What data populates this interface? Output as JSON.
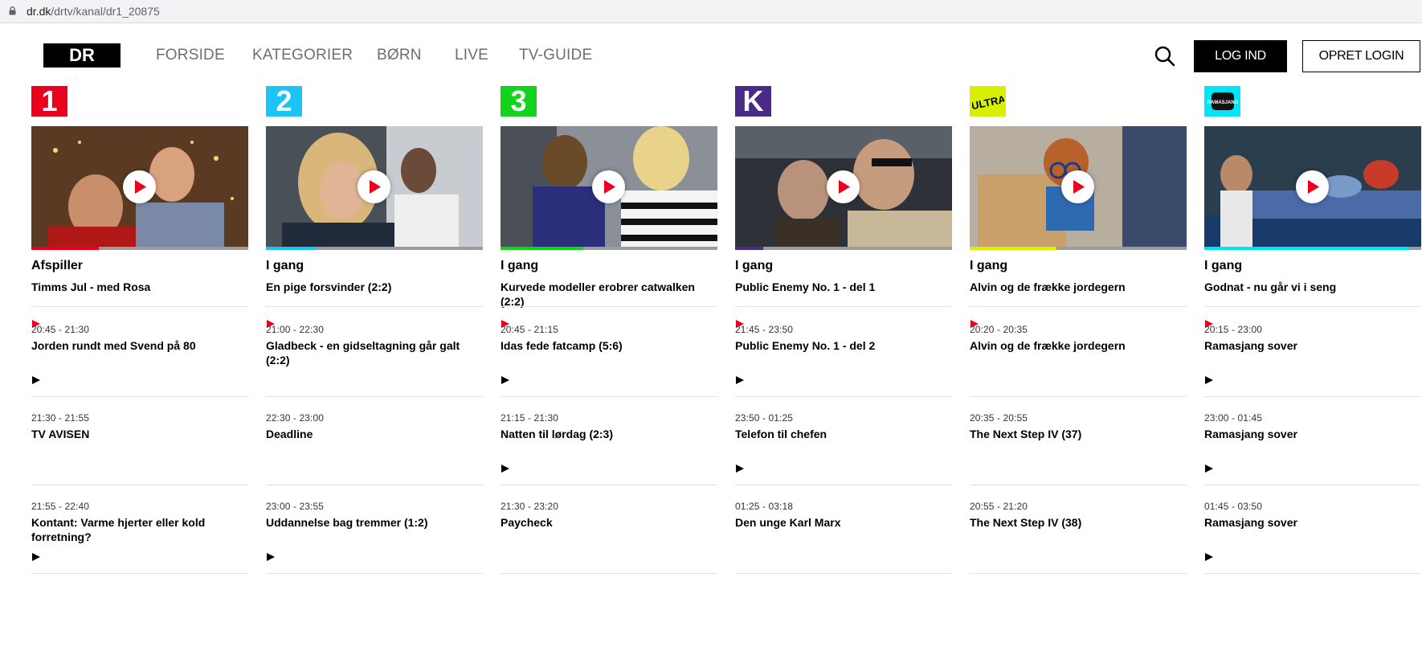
{
  "browser": {
    "url_host": "dr.dk",
    "url_path": "/drtv/kanal/dr1_20875"
  },
  "header": {
    "logo_text": "DR",
    "nav": [
      "FORSIDE",
      "KATEGORIER",
      "BØRN",
      "LIVE",
      "TV-GUIDE"
    ],
    "login_label": "LOG IND",
    "signup_label": "OPRET LOGIN",
    "search_icon": "search-icon"
  },
  "colors": {
    "dr1": "#e8001c",
    "dr2": "#1cc3f5",
    "dr3": "#13d41a",
    "drk": "#4a2a87",
    "ultra": "#d8f000",
    "ramasjang": "#00e5f5",
    "now_play_icon": "#e8001c"
  },
  "channels": [
    {
      "logo": "1",
      "progress": 0.31,
      "now": {
        "status": "Afspiller",
        "title": "Timms Jul - med Rosa"
      },
      "schedule": [
        {
          "time": "20:45 - 21:30",
          "title": "Jorden rundt med Svend på 80"
        },
        {
          "time": "21:30 - 21:55",
          "title": "TV AVISEN"
        },
        {
          "time": "21:55 - 22:40",
          "title": "Kontant: Varme hjerter eller kold forretning?"
        }
      ]
    },
    {
      "logo": "2",
      "progress": 0.23,
      "now": {
        "status": "I gang",
        "title": "En pige forsvinder (2:2)"
      },
      "schedule": [
        {
          "time": "21:00 - 22:30",
          "title": "Gladbeck - en gidseltagning går galt (2:2)"
        },
        {
          "time": "22:30 - 23:00",
          "title": "Deadline"
        },
        {
          "time": "23:00 - 23:55",
          "title": "Uddannelse bag tremmer (1:2)"
        }
      ]
    },
    {
      "logo": "3",
      "progress": 0.38,
      "now": {
        "status": "I gang",
        "title": "Kurvede modeller erobrer catwalken (2:2)"
      },
      "schedule": [
        {
          "time": "20:45 - 21:15",
          "title": "Idas fede fatcamp (5:6)"
        },
        {
          "time": "21:15 - 21:30",
          "title": "Natten til lørdag (2:3)"
        },
        {
          "time": "21:30 - 23:20",
          "title": "Paycheck"
        }
      ]
    },
    {
      "logo": "K",
      "progress": 0.13,
      "now": {
        "status": "I gang",
        "title": "Public Enemy No. 1 - del 1"
      },
      "schedule": [
        {
          "time": "21:45 - 23:50",
          "title": "Public Enemy No. 1 - del 2"
        },
        {
          "time": "23:50 - 01:25",
          "title": "Telefon til chefen"
        },
        {
          "time": "01:25 - 03:18",
          "title": "Den unge Karl Marx"
        }
      ]
    },
    {
      "logo": "ULTRA",
      "progress": 0.4,
      "now": {
        "status": "I gang",
        "title": "Alvin og de frække jordegern"
      },
      "schedule": [
        {
          "time": "20:20 - 20:35",
          "title": "Alvin og de frække jordegern"
        },
        {
          "time": "20:35 - 20:55",
          "title": "The Next Step IV (37)"
        },
        {
          "time": "20:55 - 21:20",
          "title": "The Next Step IV (38)"
        }
      ]
    },
    {
      "logo": "RAMASJANG",
      "progress": 0.94,
      "now": {
        "status": "I gang",
        "title": "Godnat - nu går vi i seng"
      },
      "schedule": [
        {
          "time": "20:15 - 23:00",
          "title": "Ramasjang sover"
        },
        {
          "time": "23:00 - 01:45",
          "title": "Ramasjang sover"
        },
        {
          "time": "01:45 - 03:50",
          "title": "Ramasjang sover"
        }
      ]
    }
  ]
}
